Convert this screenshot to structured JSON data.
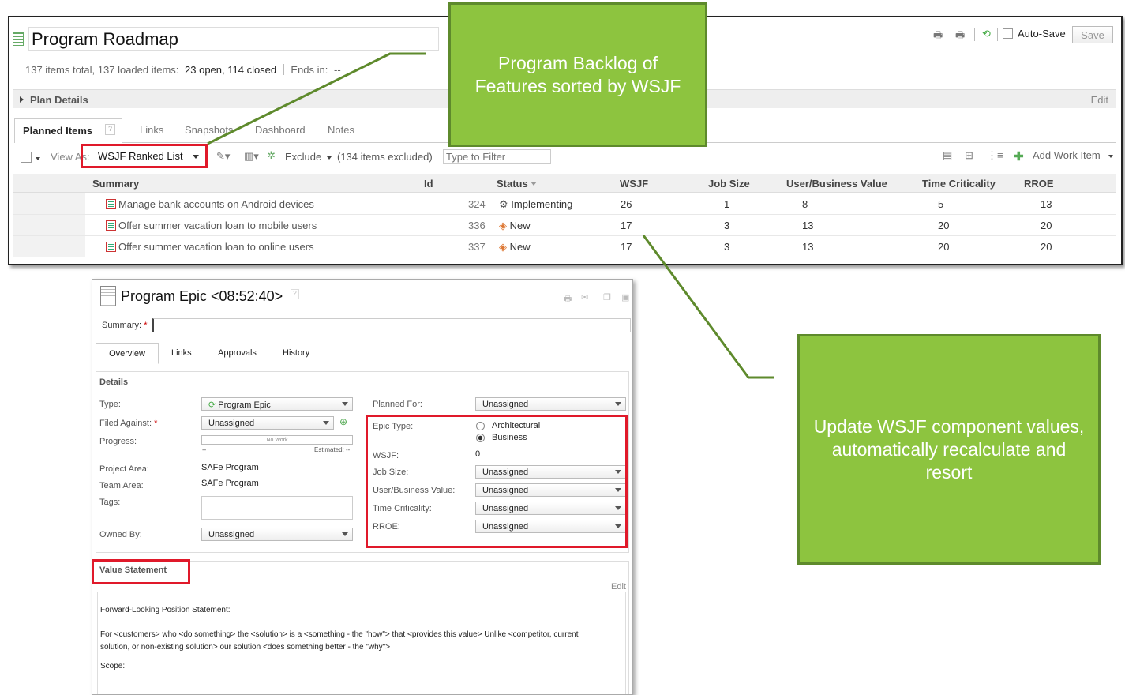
{
  "roadmap": {
    "title": "Program Roadmap",
    "summary_total": "137 items total, 137 loaded items:",
    "summary_open": "23 open, 114 closed",
    "summary_ends": "Ends in:",
    "summary_ends_val": "--",
    "auto_save": "Auto-Save",
    "save": "Save",
    "plan_details": "Plan Details",
    "edit": "Edit",
    "tabs": [
      "Planned Items",
      "Links",
      "Snapshots",
      "Dashboard",
      "Notes"
    ],
    "view_as": "View As:",
    "view_select": "WSJF Ranked List",
    "exclude": "Exclude",
    "excluded_note": "(134 items excluded)",
    "filter_placeholder": "Type to Filter",
    "add_work_item": "Add Work Item",
    "columns": [
      "Summary",
      "Id",
      "Status",
      "WSJF",
      "Job Size",
      "User/Business Value",
      "Time Criticality",
      "RROE"
    ],
    "rows": [
      {
        "summary": "Manage bank accounts on Android devices",
        "id": "324",
        "status": "Implementing",
        "wsjf": "26",
        "job_size": "1",
        "ubv": "8",
        "tc": "5",
        "rroe": "13"
      },
      {
        "summary": "Offer summer vacation loan to mobile users",
        "id": "336",
        "status": "New",
        "wsjf": "17",
        "job_size": "3",
        "ubv": "13",
        "tc": "20",
        "rroe": "20"
      },
      {
        "summary": "Offer summer vacation loan to online users",
        "id": "337",
        "status": "New",
        "wsjf": "17",
        "job_size": "3",
        "ubv": "13",
        "tc": "20",
        "rroe": "20"
      }
    ]
  },
  "epic": {
    "title": "Program Epic <08:52:40>",
    "summary_label": "Summary:",
    "required": "*",
    "tabs": [
      "Overview",
      "Links",
      "Approvals",
      "History"
    ],
    "details": "Details",
    "type_label": "Type:",
    "type_value": "Program Epic",
    "filed_against_label": "Filed Against:",
    "filed_against_value": "Unassigned",
    "progress_label": "Progress:",
    "progress_text": "No Work",
    "progress_dash": "--",
    "estimated": "Estimated: --",
    "project_area_label": "Project Area:",
    "project_area_value": "SAFe Program",
    "team_area_label": "Team Area:",
    "team_area_value": "SAFe Program",
    "tags_label": "Tags:",
    "owned_by_label": "Owned By:",
    "owned_by_value": "Unassigned",
    "planned_for_label": "Planned For:",
    "planned_for_value": "Unassigned",
    "epic_type_label": "Epic Type:",
    "epic_type_options": [
      "Architectural",
      "Business"
    ],
    "wsjf_label": "WSJF:",
    "wsjf_value": "0",
    "job_size_label": "Job Size:",
    "ubv_label": "User/Business Value:",
    "tc_label": "Time Criticality:",
    "rroe_label": "RROE:",
    "unassigned": "Unassigned",
    "value_statement": "Value Statement",
    "vs_edit": "Edit",
    "vs_line1": "Forward-Looking Position Statement:",
    "vs_line2": "For <customers> who <do something> the <solution> is a <something - the \"how\"> that <provides this value> Unlike <competitor, current",
    "vs_line3": "solution, or non-existing solution> our solution <does something better - the \"why\">",
    "vs_line4": "Scope:"
  },
  "callouts": {
    "top": "Program Backlog of Features sorted by WSJF",
    "right": "Update WSJF component values, automatically recalculate and resort"
  },
  "colors": {
    "callout_fill": "#8dc43f",
    "callout_border": "#5e8a2c",
    "highlight": "#e0192a",
    "connector": "#5e8a2c"
  }
}
